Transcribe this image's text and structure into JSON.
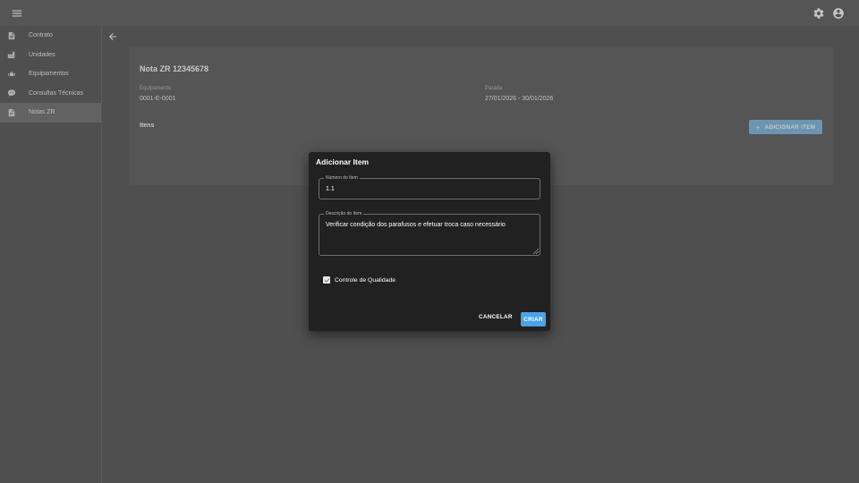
{
  "sidebar": {
    "items": [
      {
        "label": "Contrato",
        "icon": "document-icon"
      },
      {
        "label": "Unidades",
        "icon": "factory-icon"
      },
      {
        "label": "Equipamentos",
        "icon": "equipment-icon"
      },
      {
        "label": "Consultas Técnicas",
        "icon": "chat-icon"
      },
      {
        "label": "Notas ZR",
        "icon": "note-icon"
      }
    ],
    "active_index": 4
  },
  "card": {
    "title": "Nota ZR 12345678",
    "equipment_label": "Equipamento",
    "equipment_value": "0001-E-0001",
    "stop_label": "Parada",
    "stop_value": "27/01/2026 - 30/01/2026",
    "items_heading": "Itens",
    "add_item_label": "ADICIONAR ITEM",
    "add_item_icon": "+"
  },
  "dialog": {
    "title": "Adicionar Item",
    "item_number_label": "Número do Item",
    "item_number_value": "1.1",
    "description_label": "Descrição do Item",
    "description_value": "Verificar condição dos parafusos e efetuar troca caso necessário",
    "quality_control_label": "Controle de Qualidade",
    "quality_control_checked": true,
    "cancel_label": "CANCELAR",
    "create_label": "CRIAR"
  },
  "colors": {
    "accent": "#4aa3e6",
    "surface": "#1e1e1e",
    "dialog": "#212121",
    "active_nav": "#383838"
  }
}
